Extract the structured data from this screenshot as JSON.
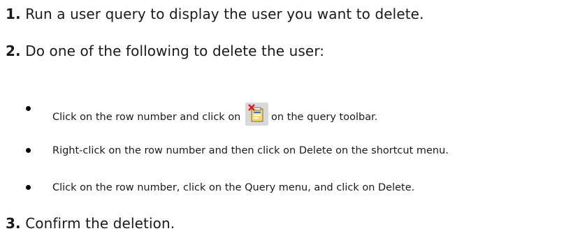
{
  "steps": [
    {
      "number": "1.",
      "text": "Run a user query to display the user you want to delete."
    },
    {
      "number": "2.",
      "text": "Do one of the following to delete the user:"
    },
    {
      "number": "3.",
      "text": "Confirm the deletion."
    }
  ],
  "bullets": [
    {
      "text_before_icon": "Click on the row number and click on",
      "icon": "delete-row-icon",
      "text_after_icon": "on the query toolbar."
    },
    {
      "text": "Right-click on the row number and then click on Delete on the shortcut menu."
    },
    {
      "text": "Click on the row number, click on the Query menu, and click on Delete."
    }
  ]
}
